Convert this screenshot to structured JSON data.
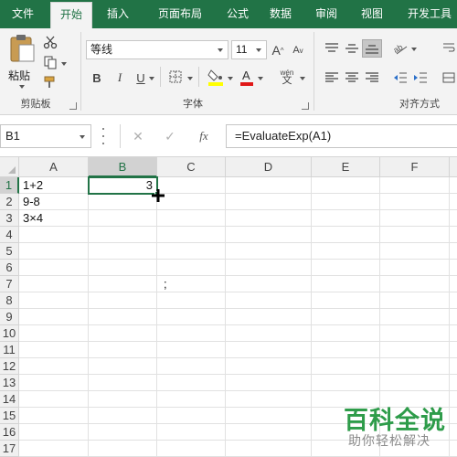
{
  "ribbon_tabs": [
    "文件",
    "开始",
    "插入",
    "页面布局",
    "公式",
    "数据",
    "审阅",
    "视图",
    "开发工具"
  ],
  "active_tab": "开始",
  "clipboard": {
    "paste_label": "粘贴",
    "group_label": "剪贴板"
  },
  "font": {
    "name": "等线",
    "size": "11",
    "group_label": "字体",
    "bold": "B",
    "italic": "I",
    "underline": "U",
    "grow": "A",
    "shrink": "A",
    "phonetic": "wén"
  },
  "alignment": {
    "group_label": "对齐方式"
  },
  "formula_bar": {
    "name_box": "B1",
    "cancel": "✕",
    "enter": "✓",
    "fx": "fx",
    "formula": "=EvaluateExp(A1)"
  },
  "grid": {
    "columns": [
      "A",
      "B",
      "C",
      "D",
      "E",
      "F"
    ],
    "rows": [
      "1",
      "2",
      "3",
      "4",
      "5",
      "6",
      "7",
      "8",
      "9",
      "10",
      "11",
      "12",
      "13",
      "14",
      "15",
      "16",
      "17"
    ],
    "selected_cell": "B1",
    "cells": {
      "A1": "1+2",
      "A2": "9-8",
      "A3": "3×4",
      "B1": "3",
      "C7": ";"
    }
  },
  "watermark": {
    "title": "百科全说",
    "subtitle": "助你轻松解决"
  },
  "colors": {
    "excel_green": "#217346",
    "watermark_green": "#2e9c4a"
  }
}
